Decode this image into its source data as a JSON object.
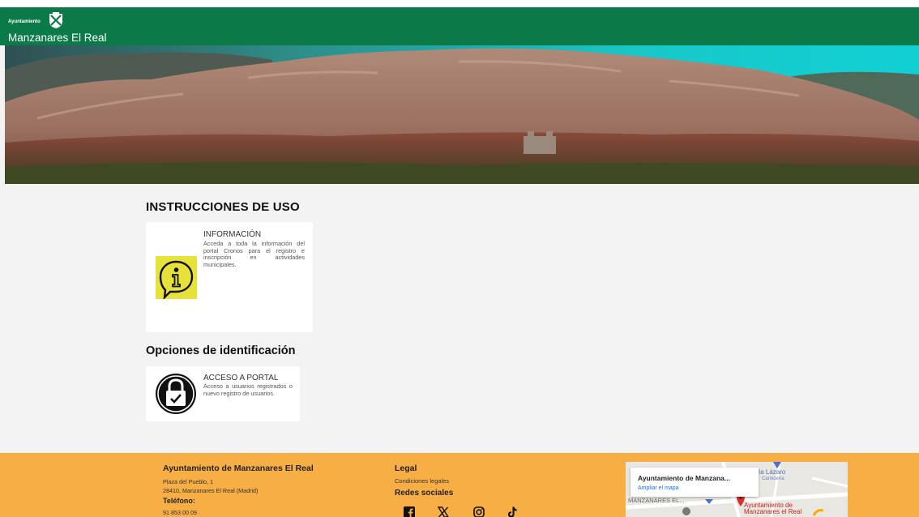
{
  "header": {
    "logo_small": "Ayuntamiento",
    "logo_name": "Manzanares El Real",
    "brand_color": "#0b7a48"
  },
  "main": {
    "title": "INSTRUCCIONES DE USO",
    "info_card": {
      "title": "INFORMACIÓN",
      "description": "Acceda a toda la información del portal Cronos para el registro e inscripción en actividades municipales.",
      "icon": "info-speech-bubble-icon",
      "icon_color": "#e6e23a"
    },
    "subtitle": "Opciones de identificación",
    "portal_card": {
      "title": "ACCESO A PORTAL",
      "description": "Acceso a usuarios registrados o nuevo registro de usuarios.",
      "icon": "lock-icon"
    }
  },
  "footer": {
    "background": "#f7ae44",
    "org_name": "Ayuntamiento de Manzanares El Real",
    "address_line1": "Plaza del Pueblo, 1",
    "address_line2": "28410, Manzanares El Real (Madrid)",
    "phone_label": "Teléfono:",
    "phone": "91 853 00 09",
    "legal_title": "Legal",
    "legal_link": "Condiciones legales",
    "social_title": "Redes sociales",
    "social_icons": [
      "facebook-icon",
      "x-icon",
      "instagram-icon",
      "tiktok-icon"
    ],
    "map": {
      "card_title": "Ayuntamiento de Manzana...",
      "card_link": "Ampliar el mapa",
      "label_lazaro": "ía Lázaro",
      "label_carniceria": "Carnicería",
      "label_manzanares": "MANZANARES EL...",
      "label_ayto_line1": "Ayuntamiento de",
      "label_ayto_line2": "Manzanares el Real"
    }
  }
}
